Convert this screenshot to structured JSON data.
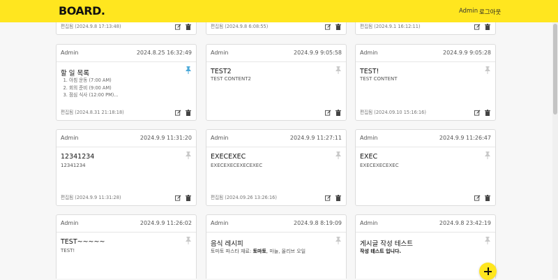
{
  "header": {
    "logo": "BOARD.",
    "user": "Admin",
    "logout": "로그아웃"
  },
  "top_row": [
    {
      "edited": "편집됨 (2024.9.8 17:13:48)"
    },
    {
      "edited": "편집됨 (2024.9.8 6:08:55)"
    },
    {
      "edited": "편집됨 (2024.9.1 16:12:11)"
    }
  ],
  "cards": [
    {
      "author": "Admin",
      "date": "2024.8.25 16:32:49",
      "title": "할 일 목록",
      "pinned": true,
      "list": [
        "아침 운동 (7:00 AM)",
        "회의 준비 (9:00 AM)",
        "점심 식사 (12:00 PM)..."
      ],
      "edited": "편집됨 (2024.8.31 21:18:18)"
    },
    {
      "author": "Admin",
      "date": "2024.9.9 9:05:58",
      "title": "TEST2",
      "content": "TEST CONTENT2",
      "edited": ""
    },
    {
      "author": "Admin",
      "date": "2024.9.9 9:05:28",
      "title": "TEST!",
      "content": "TEST CONTENT",
      "edited": "편집됨 (2024.09.10 15:16:16)"
    },
    {
      "author": "Admin",
      "date": "2024.9.9 11:31:20",
      "title": "12341234",
      "content": "12341234",
      "edited": "편집됨 (2024.9.9 11:31:28)"
    },
    {
      "author": "Admin",
      "date": "2024.9.9 11:27:11",
      "title": "EXECEXEC",
      "content": "EXECEXECEXECEXEC",
      "edited": "편집됨 (2024.09.26 13:26:16)"
    },
    {
      "author": "Admin",
      "date": "2024.9.9 11:26:47",
      "title": "EXEC",
      "content": "EXECEXECEXEC",
      "edited": ""
    },
    {
      "author": "Admin",
      "date": "2024.9.9 11:26:02",
      "title": "TEST~~~~~",
      "content": "TEST!"
    },
    {
      "author": "Admin",
      "date": "2024.9.8 8:19:09",
      "title": "음식 레시피",
      "content_pre": "토마토 파스타 재료: ",
      "content_bold": "토마토",
      "content_post": ", 마늘, 올리브 오일"
    },
    {
      "author": "Admin",
      "date": "2024.9.8 23:42:19",
      "title": "게시글 작성 테스트",
      "content_bold": "작성 테스트 입니다."
    }
  ],
  "colors": {
    "accent": "#ffe61f",
    "pin_active": "#4aa8d8",
    "pin_inactive": "#c8c8c8"
  },
  "fab": {
    "icon": "plus-icon"
  }
}
